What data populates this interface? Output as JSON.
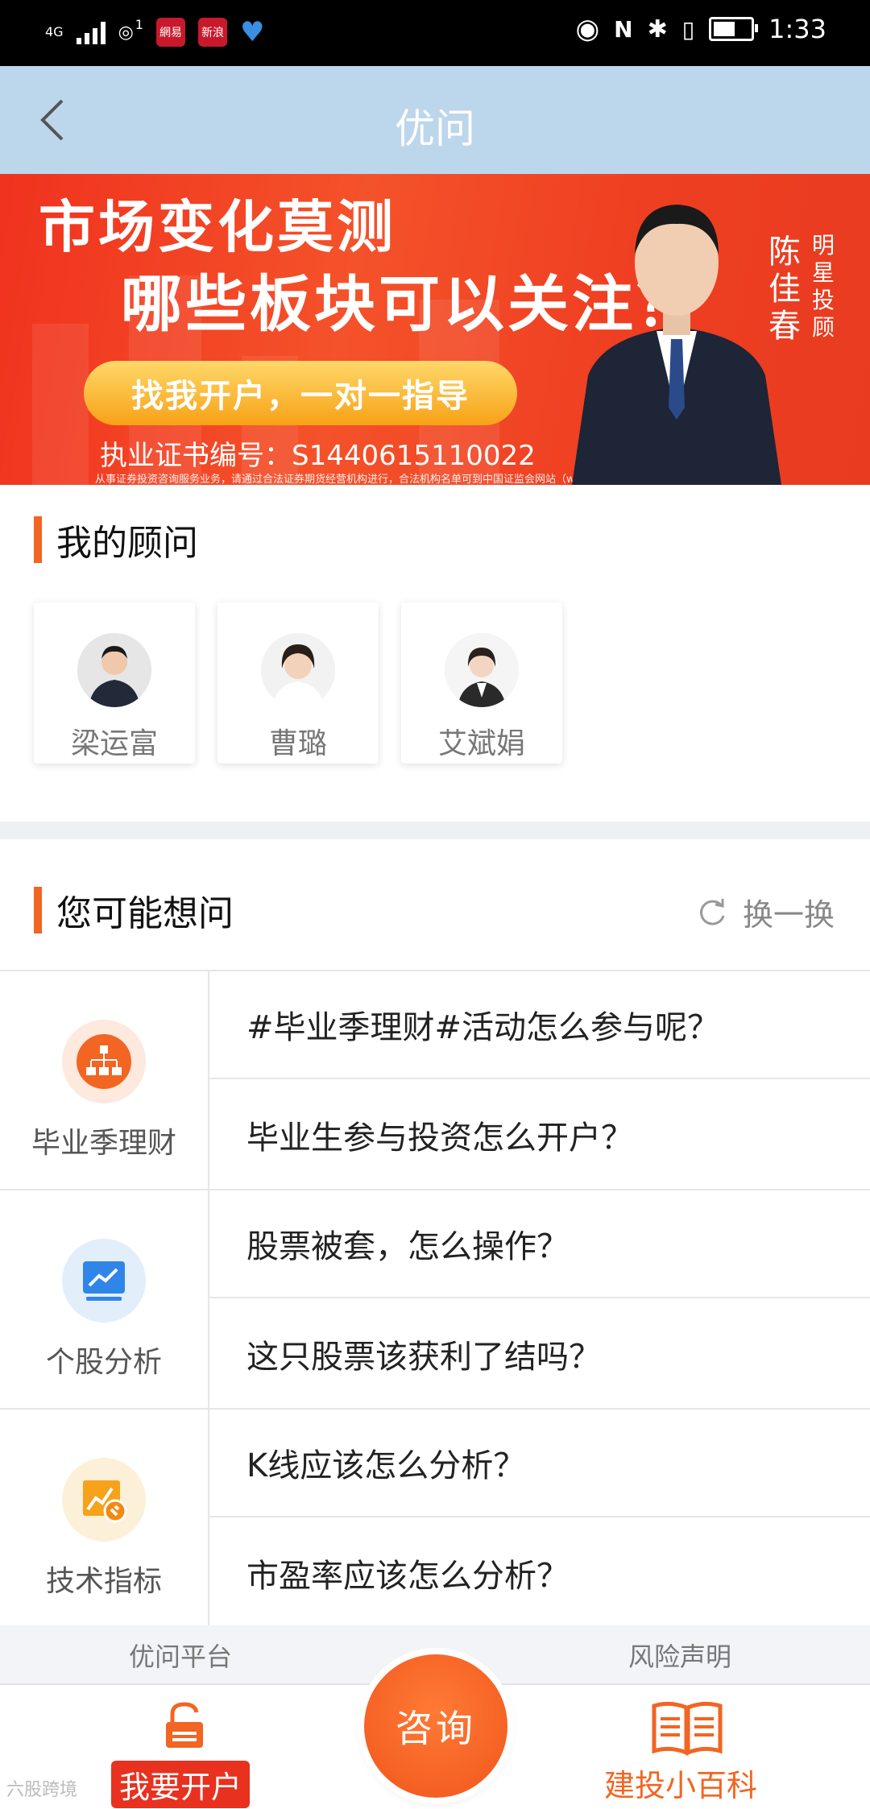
{
  "status_bar": {
    "network": "4G",
    "sim_badge": "1",
    "app_badges": [
      "網易",
      "新浪"
    ],
    "time": "1:33"
  },
  "nav": {
    "title": "优问"
  },
  "banner": {
    "line1": "市场变化莫测",
    "line2": "哪些板块可以关注？",
    "button": "找我开户，一对一指导",
    "cert": "执业证书编号：S1440615110022",
    "fine_print": "从事证券投资咨询服务业务，请通过合法证券期货经营机构进行，合法机构名单可到中国证监会网站（www.csrc.gov.cn）查询",
    "name": "陈佳春",
    "tag": "明星投顾"
  },
  "advisors_section": {
    "title": "我的顾问",
    "advisors": [
      {
        "name": "梁运富"
      },
      {
        "name": "曹璐"
      },
      {
        "name": "艾斌娟"
      }
    ]
  },
  "questions_section": {
    "title": "您可能想问",
    "refresh_label": "换一换",
    "groups": [
      {
        "category": "毕业季理财",
        "icon": "org-chart-icon",
        "icon_color": "#f26522",
        "icon_bg": "#fde9dd",
        "questions": [
          "#毕业季理财#活动怎么参与呢？",
          "毕业生参与投资怎么开户？"
        ]
      },
      {
        "category": "个股分析",
        "icon": "trend-chart-icon",
        "icon_color": "#2f86e8",
        "icon_bg": "#e3eefb",
        "questions": [
          "股票被套，怎么操作？",
          "这只股票该获利了结吗？"
        ]
      },
      {
        "category": "技术指标",
        "icon": "chart-wrench-icon",
        "icon_color": "#f7a21b",
        "icon_bg": "#fdf0d8",
        "questions": [
          "K线应该怎么分析？",
          "市盈率应该怎么分析？"
        ]
      }
    ]
  },
  "footer": {
    "link_left": "优问平台",
    "link_right": "风险声明",
    "tab_open_account": "我要开户",
    "tab_consult": "咨询",
    "tab_encyclopedia": "建投小百科"
  },
  "watermark": "六股跨境",
  "colors": {
    "accent": "#f26522",
    "nav_bg": "#bcd6ec",
    "banner_red": "#f0321e"
  }
}
